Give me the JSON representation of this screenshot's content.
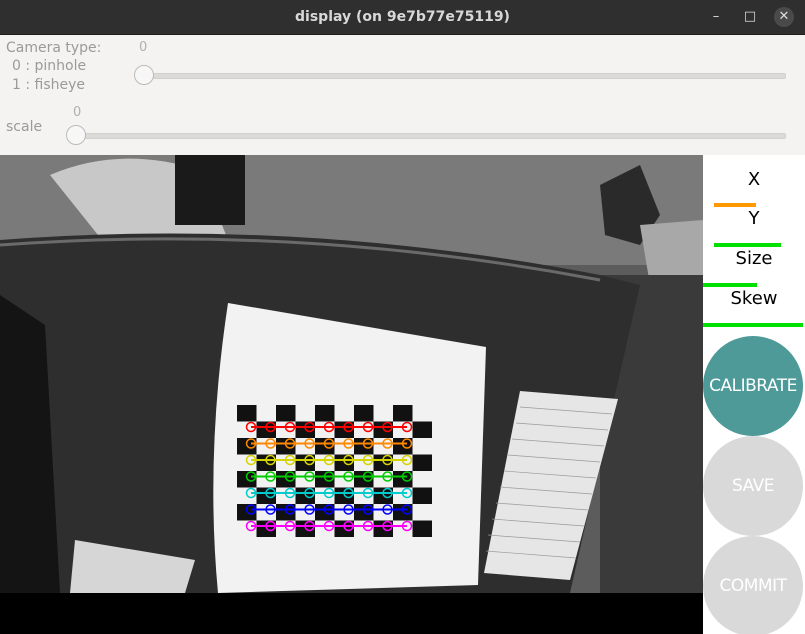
{
  "window": {
    "title": "display (on 9e7b77e75119)",
    "minimize_glyph": "–",
    "maximize_glyph": "□",
    "close_glyph": "✕"
  },
  "controls": {
    "camera_type": {
      "label": "Camera type:",
      "option0": "0 : pinhole",
      "option1": "1 : fisheye",
      "value": "0"
    },
    "scale": {
      "label": "scale",
      "value": "0"
    }
  },
  "sidebar": {
    "x_label": "X",
    "y_label": "Y",
    "size_label": "Size",
    "skew_label": "Skew",
    "calibrate_label": "CALIBRATE",
    "save_label": "SAVE",
    "commit_label": "COMMIT",
    "x_progress": 0.46,
    "y_progress": 0.74,
    "size_progress": 0.55,
    "skew_progress": 1.0,
    "x_color": "#ff9900",
    "progress_color": "#00e000",
    "calibrate_color": "#4d9a99",
    "disabled_color": "#d9d9d9"
  },
  "camera_view": {
    "corner_row_colors": [
      "#ff0000",
      "#ff8800",
      "#d4d400",
      "#00cc00",
      "#00cccc",
      "#0000ff",
      "#ff00ff"
    ]
  }
}
